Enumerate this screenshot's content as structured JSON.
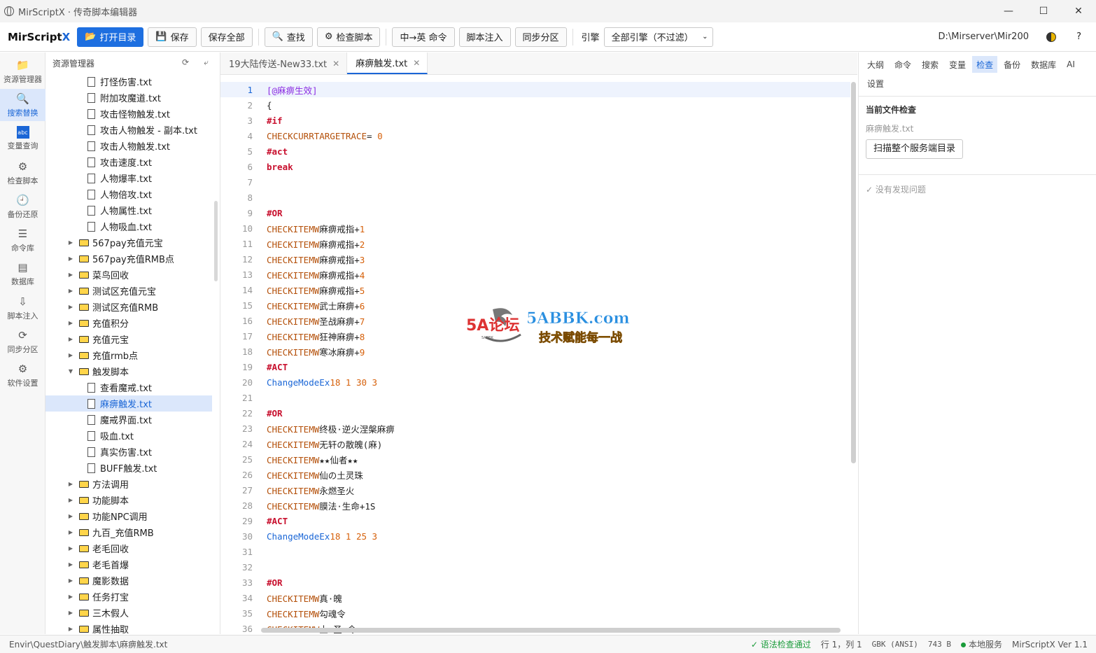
{
  "window": {
    "title": "MirScriptX · 传奇脚本编辑器",
    "min": "—",
    "max": "☐",
    "close": "✕"
  },
  "toolbar": {
    "brand_a": "MirScript",
    "brand_b": "X",
    "open": "打开目录",
    "save": "保存",
    "save_all": "保存全部",
    "find": "查找",
    "check": "检查脚本",
    "cn_en": "中→英 命令",
    "inject": "脚本注入",
    "sync": "同步分区",
    "engine_label": "引擎",
    "engine_value": "全部引擎（不过滤）",
    "path": "D:\\Mirserver\\Mir200",
    "help": "?"
  },
  "activity": [
    {
      "label": "资源管理器",
      "icon": "folder-icon",
      "glyph": "📁"
    },
    {
      "label": "搜索替换",
      "icon": "search-icon",
      "glyph": "🔍"
    },
    {
      "label": "变量查询",
      "icon": "variable-icon",
      "glyph": "abc"
    },
    {
      "label": "检查脚本",
      "icon": "inspect-icon",
      "glyph": "⚙"
    },
    {
      "label": "备份还原",
      "icon": "clock-icon",
      "glyph": "🕘"
    },
    {
      "label": "命令库",
      "icon": "book-icon",
      "glyph": "☰"
    },
    {
      "label": "数据库",
      "icon": "database-icon",
      "glyph": "▤"
    },
    {
      "label": "脚本注入",
      "icon": "inject-icon",
      "glyph": "⇩"
    },
    {
      "label": "同步分区",
      "icon": "sync-icon",
      "glyph": "⟳"
    },
    {
      "label": "软件设置",
      "icon": "gear-icon",
      "glyph": "⚙"
    }
  ],
  "explorer": {
    "title": "资源管理器",
    "refresh": "⟳",
    "collapse": "⤶",
    "items": [
      {
        "type": "file",
        "label": "打怪伤害.txt",
        "indent": 2
      },
      {
        "type": "file",
        "label": "附加攻魔道.txt",
        "indent": 2
      },
      {
        "type": "file",
        "label": "攻击怪物触发.txt",
        "indent": 2
      },
      {
        "type": "file",
        "label": "攻击人物触发 - 副本.txt",
        "indent": 2
      },
      {
        "type": "file",
        "label": "攻击人物触发.txt",
        "indent": 2
      },
      {
        "type": "file",
        "label": "攻击速度.txt",
        "indent": 2
      },
      {
        "type": "file",
        "label": "人物爆率.txt",
        "indent": 2
      },
      {
        "type": "file",
        "label": "人物倍攻.txt",
        "indent": 2
      },
      {
        "type": "file",
        "label": "人物属性.txt",
        "indent": 2
      },
      {
        "type": "file",
        "label": "人物吸血.txt",
        "indent": 2
      },
      {
        "type": "folder",
        "label": "567pay充值元宝",
        "indent": 1,
        "open": false
      },
      {
        "type": "folder",
        "label": "567pay充值RMB点",
        "indent": 1,
        "open": false
      },
      {
        "type": "folder",
        "label": "菜鸟回收",
        "indent": 1,
        "open": false
      },
      {
        "type": "folder",
        "label": "测试区充值元宝",
        "indent": 1,
        "open": false
      },
      {
        "type": "folder",
        "label": "测试区充值RMB",
        "indent": 1,
        "open": false
      },
      {
        "type": "folder",
        "label": "充值积分",
        "indent": 1,
        "open": false
      },
      {
        "type": "folder",
        "label": "充值元宝",
        "indent": 1,
        "open": false
      },
      {
        "type": "folder",
        "label": "充值rmb点",
        "indent": 1,
        "open": false
      },
      {
        "type": "folder",
        "label": "触发脚本",
        "indent": 1,
        "open": true
      },
      {
        "type": "file",
        "label": "查看魔戒.txt",
        "indent": 2
      },
      {
        "type": "file",
        "label": "麻痹触发.txt",
        "indent": 2,
        "selected": true
      },
      {
        "type": "file",
        "label": "魔戒界面.txt",
        "indent": 2
      },
      {
        "type": "file",
        "label": "吸血.txt",
        "indent": 2
      },
      {
        "type": "file",
        "label": "真实伤害.txt",
        "indent": 2
      },
      {
        "type": "file",
        "label": "BUFF触发.txt",
        "indent": 2
      },
      {
        "type": "folder",
        "label": "方法调用",
        "indent": 1,
        "open": false
      },
      {
        "type": "folder",
        "label": "功能脚本",
        "indent": 1,
        "open": false
      },
      {
        "type": "folder",
        "label": "功能NPC调用",
        "indent": 1,
        "open": false
      },
      {
        "type": "folder",
        "label": "九百_充值RMB",
        "indent": 1,
        "open": false
      },
      {
        "type": "folder",
        "label": "老毛回收",
        "indent": 1,
        "open": false
      },
      {
        "type": "folder",
        "label": "老毛首爆",
        "indent": 1,
        "open": false
      },
      {
        "type": "folder",
        "label": "魔影数据",
        "indent": 1,
        "open": false
      },
      {
        "type": "folder",
        "label": "任务打宝",
        "indent": 1,
        "open": false
      },
      {
        "type": "folder",
        "label": "三木假人",
        "indent": 1,
        "open": false
      },
      {
        "type": "folder",
        "label": "属性抽取",
        "indent": 1,
        "open": false
      }
    ]
  },
  "tabs": [
    {
      "label": "19大陆传送-New33.txt",
      "close": "✕",
      "active": false
    },
    {
      "label": "麻痹触发.txt",
      "close": "✕",
      "active": true
    }
  ],
  "code": [
    {
      "n": "1",
      "s": [
        [
          "[@麻痹生效]",
          "sec"
        ]
      ]
    },
    {
      "n": "2",
      "s": [
        [
          "{",
          ""
        ]
      ]
    },
    {
      "n": "3",
      "s": [
        [
          "#if",
          "kw"
        ]
      ]
    },
    {
      "n": "4",
      "s": [
        [
          "CHECKCURRTARGETRACE",
          "fn"
        ],
        [
          "= ",
          ""
        ],
        [
          "0",
          "num"
        ]
      ]
    },
    {
      "n": "5",
      "s": [
        [
          "#act",
          "kw"
        ]
      ]
    },
    {
      "n": "6",
      "s": [
        [
          "break",
          "kw"
        ]
      ]
    },
    {
      "n": "7",
      "s": []
    },
    {
      "n": "8",
      "s": []
    },
    {
      "n": "9",
      "s": [
        [
          "#OR",
          "kw"
        ]
      ]
    },
    {
      "n": "10",
      "s": [
        [
          "CHECKITEMW",
          "fn"
        ],
        [
          "麻痹戒指+",
          ""
        ],
        [
          "1",
          "num"
        ]
      ]
    },
    {
      "n": "11",
      "s": [
        [
          "CHECKITEMW",
          "fn"
        ],
        [
          "麻痹戒指+",
          ""
        ],
        [
          "2",
          "num"
        ]
      ]
    },
    {
      "n": "12",
      "s": [
        [
          "CHECKITEMW",
          "fn"
        ],
        [
          "麻痹戒指+",
          ""
        ],
        [
          "3",
          "num"
        ]
      ]
    },
    {
      "n": "13",
      "s": [
        [
          "CHECKITEMW",
          "fn"
        ],
        [
          "麻痹戒指+",
          ""
        ],
        [
          "4",
          "num"
        ]
      ]
    },
    {
      "n": "14",
      "s": [
        [
          "CHECKITEMW",
          "fn"
        ],
        [
          "麻痹戒指+",
          ""
        ],
        [
          "5",
          "num"
        ]
      ]
    },
    {
      "n": "15",
      "s": [
        [
          "CHECKITEMW",
          "fn"
        ],
        [
          "武士麻痹+",
          ""
        ],
        [
          "6",
          "num"
        ]
      ]
    },
    {
      "n": "16",
      "s": [
        [
          "CHECKITEMW",
          "fn"
        ],
        [
          "圣战麻痹+",
          ""
        ],
        [
          "7",
          "num"
        ]
      ]
    },
    {
      "n": "17",
      "s": [
        [
          "CHECKITEMW",
          "fn"
        ],
        [
          "狂神麻痹+",
          ""
        ],
        [
          "8",
          "num"
        ]
      ]
    },
    {
      "n": "18",
      "s": [
        [
          "CHECKITEMW",
          "fn"
        ],
        [
          "寒冰麻痹+",
          ""
        ],
        [
          "9",
          "num"
        ]
      ]
    },
    {
      "n": "19",
      "s": [
        [
          "#ACT",
          "kw"
        ]
      ]
    },
    {
      "n": "20",
      "s": [
        [
          "ChangeModeEx",
          "act"
        ],
        [
          "18 1 30 3",
          "num"
        ]
      ]
    },
    {
      "n": "21",
      "s": []
    },
    {
      "n": "22",
      "s": [
        [
          "#OR",
          "kw"
        ]
      ]
    },
    {
      "n": "23",
      "s": [
        [
          "CHECKITEMW",
          "fn"
        ],
        [
          "终极·逆火涅槃麻痹",
          ""
        ]
      ]
    },
    {
      "n": "24",
      "s": [
        [
          "CHECKITEMW",
          "fn"
        ],
        [
          "无轩の散魄(麻)",
          ""
        ]
      ]
    },
    {
      "n": "25",
      "s": [
        [
          "CHECKITEMW",
          "fn"
        ],
        [
          "★★仙者★★",
          ""
        ]
      ]
    },
    {
      "n": "26",
      "s": [
        [
          "CHECKITEMW",
          "fn"
        ],
        [
          "仙の土灵珠",
          ""
        ]
      ]
    },
    {
      "n": "27",
      "s": [
        [
          "CHECKITEMW",
          "fn"
        ],
        [
          "永燃圣火",
          ""
        ]
      ]
    },
    {
      "n": "28",
      "s": [
        [
          "CHECKITEMW",
          "fn"
        ],
        [
          "膜法·生命+1S",
          ""
        ]
      ]
    },
    {
      "n": "29",
      "s": [
        [
          "#ACT",
          "kw"
        ]
      ]
    },
    {
      "n": "30",
      "s": [
        [
          "ChangeModeEx",
          "act"
        ],
        [
          "18 1 25 3",
          "num"
        ]
      ]
    },
    {
      "n": "31",
      "s": []
    },
    {
      "n": "32",
      "s": []
    },
    {
      "n": "33",
      "s": [
        [
          "#OR",
          "kw"
        ]
      ]
    },
    {
      "n": "34",
      "s": [
        [
          "CHECKITEMW",
          "fn"
        ],
        [
          "真·魄",
          ""
        ]
      ]
    },
    {
      "n": "35",
      "s": [
        [
          "CHECKITEMW",
          "fn"
        ],
        [
          "勾魂令",
          ""
        ]
      ]
    },
    {
      "n": "36",
      "s": [
        [
          "CHECKITEMW",
          "fn"
        ],
        [
          "土·圣·令",
          ""
        ]
      ]
    }
  ],
  "watermark": {
    "logo": "5A论坛",
    "sub": "5ABBK",
    "domain": "5ABBK.com",
    "slogan": "技术赋能每一战"
  },
  "right_panel": {
    "tabs": [
      "大纲",
      "命令",
      "搜索",
      "变量",
      "检查",
      "备份",
      "数据库",
      "AI",
      "设置"
    ],
    "active_tab": "检查",
    "section_title": "当前文件检查",
    "file": "麻痹触发.txt",
    "scan_button": "扫描整个服务端目录",
    "result": "✓ 没有发现问题"
  },
  "status": {
    "path": "Envir\\QuestDiary\\触发脚本\\麻痹触发.txt",
    "syntax": "✓ 语法检查通过",
    "position": "行 1，列 1",
    "encoding": "GBK (ANSI)",
    "size": "743 B",
    "service": "本地服务",
    "version": "MirScriptX Ver 1.1"
  },
  "colors": {
    "accent": "#1e6fe0",
    "selected_bg": "#dbe7fb",
    "keyword": "#c8102e",
    "function": "#b4500a",
    "number": "#d6600a",
    "ok": "#1a9b3a"
  }
}
